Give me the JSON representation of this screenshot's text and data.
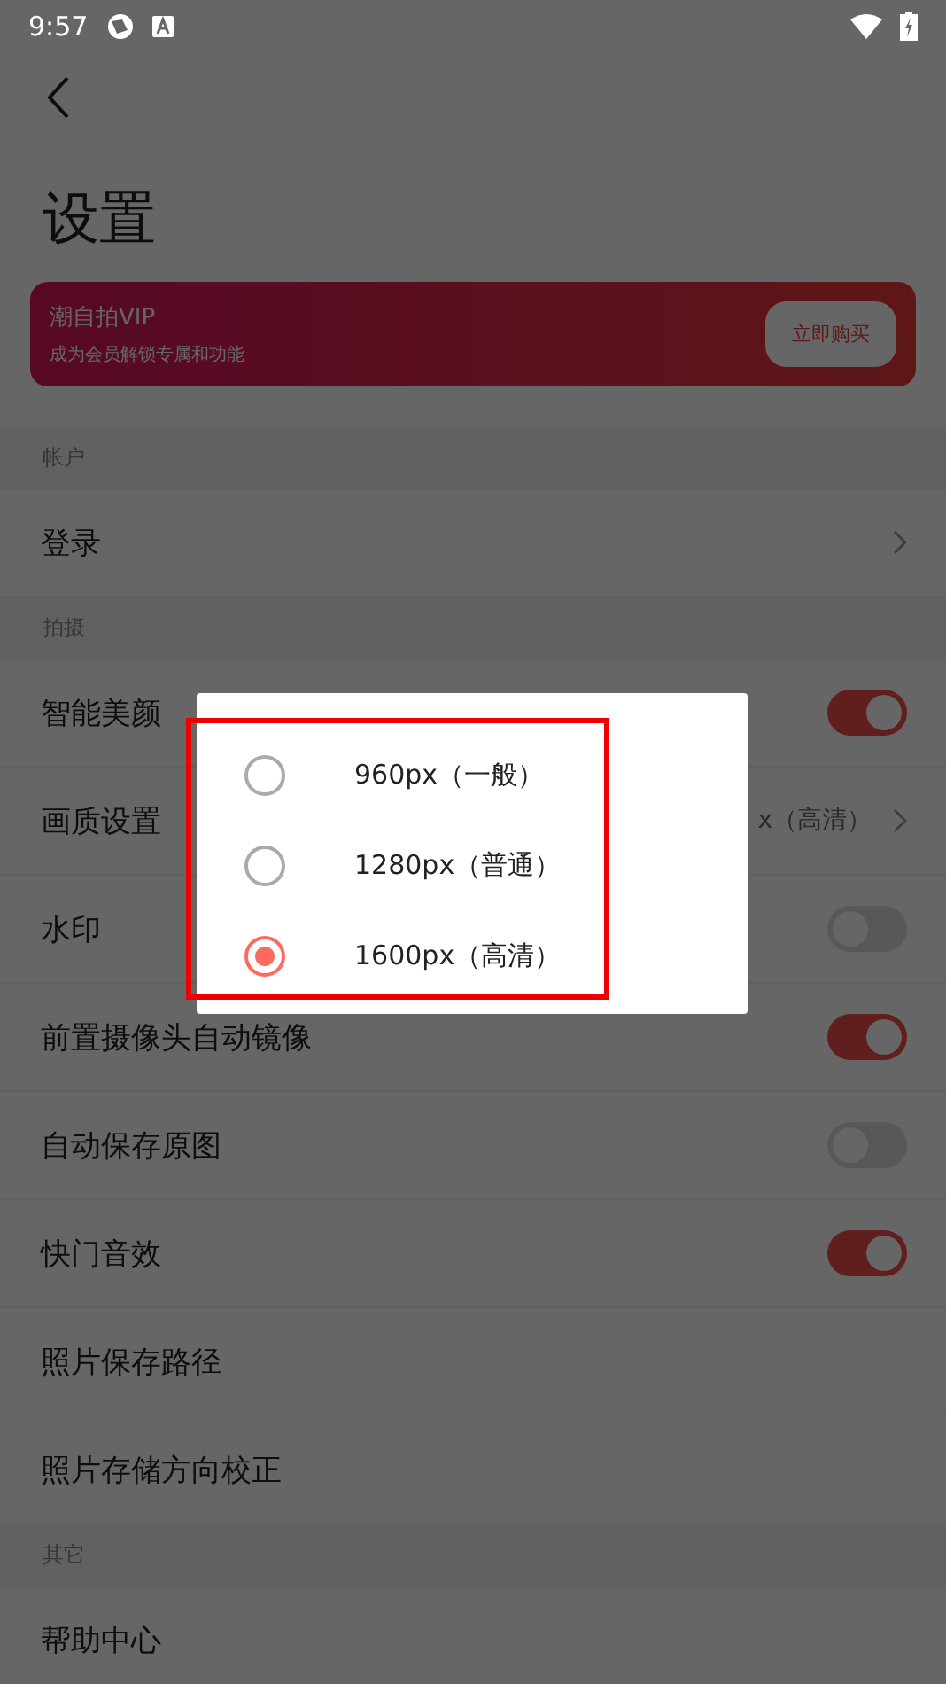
{
  "status_bar": {
    "time": "9:57"
  },
  "header": {
    "title": "设置"
  },
  "vip_banner": {
    "title": "潮自拍VIP",
    "subtitle": "成为会员解锁专属和功能",
    "button": "立即购买"
  },
  "sections": [
    {
      "header": "帐户",
      "rows": [
        {
          "kind": "link",
          "label": "登录"
        }
      ]
    },
    {
      "header": "拍摄",
      "rows": [
        {
          "kind": "toggle",
          "label": "智能美颜",
          "on": true
        },
        {
          "kind": "link",
          "label": "画质设置",
          "value": "x（高清）"
        },
        {
          "kind": "toggle",
          "label": "水印",
          "on": false
        },
        {
          "kind": "toggle",
          "label": "前置摄像头自动镜像",
          "on": true
        },
        {
          "kind": "toggle",
          "label": "自动保存原图",
          "on": false
        },
        {
          "kind": "toggle",
          "label": "快门音效",
          "on": true
        },
        {
          "kind": "plain",
          "label": "照片保存路径"
        },
        {
          "kind": "plain",
          "label": "照片存储方向校正"
        }
      ]
    },
    {
      "header": "其它",
      "rows": [
        {
          "kind": "plain",
          "label": "帮助中心"
        }
      ]
    }
  ],
  "dialog": {
    "options": [
      {
        "label": "960px（一般）",
        "selected": false
      },
      {
        "label": "1280px（普通）",
        "selected": false
      },
      {
        "label": "1600px（高清）",
        "selected": true
      }
    ]
  }
}
